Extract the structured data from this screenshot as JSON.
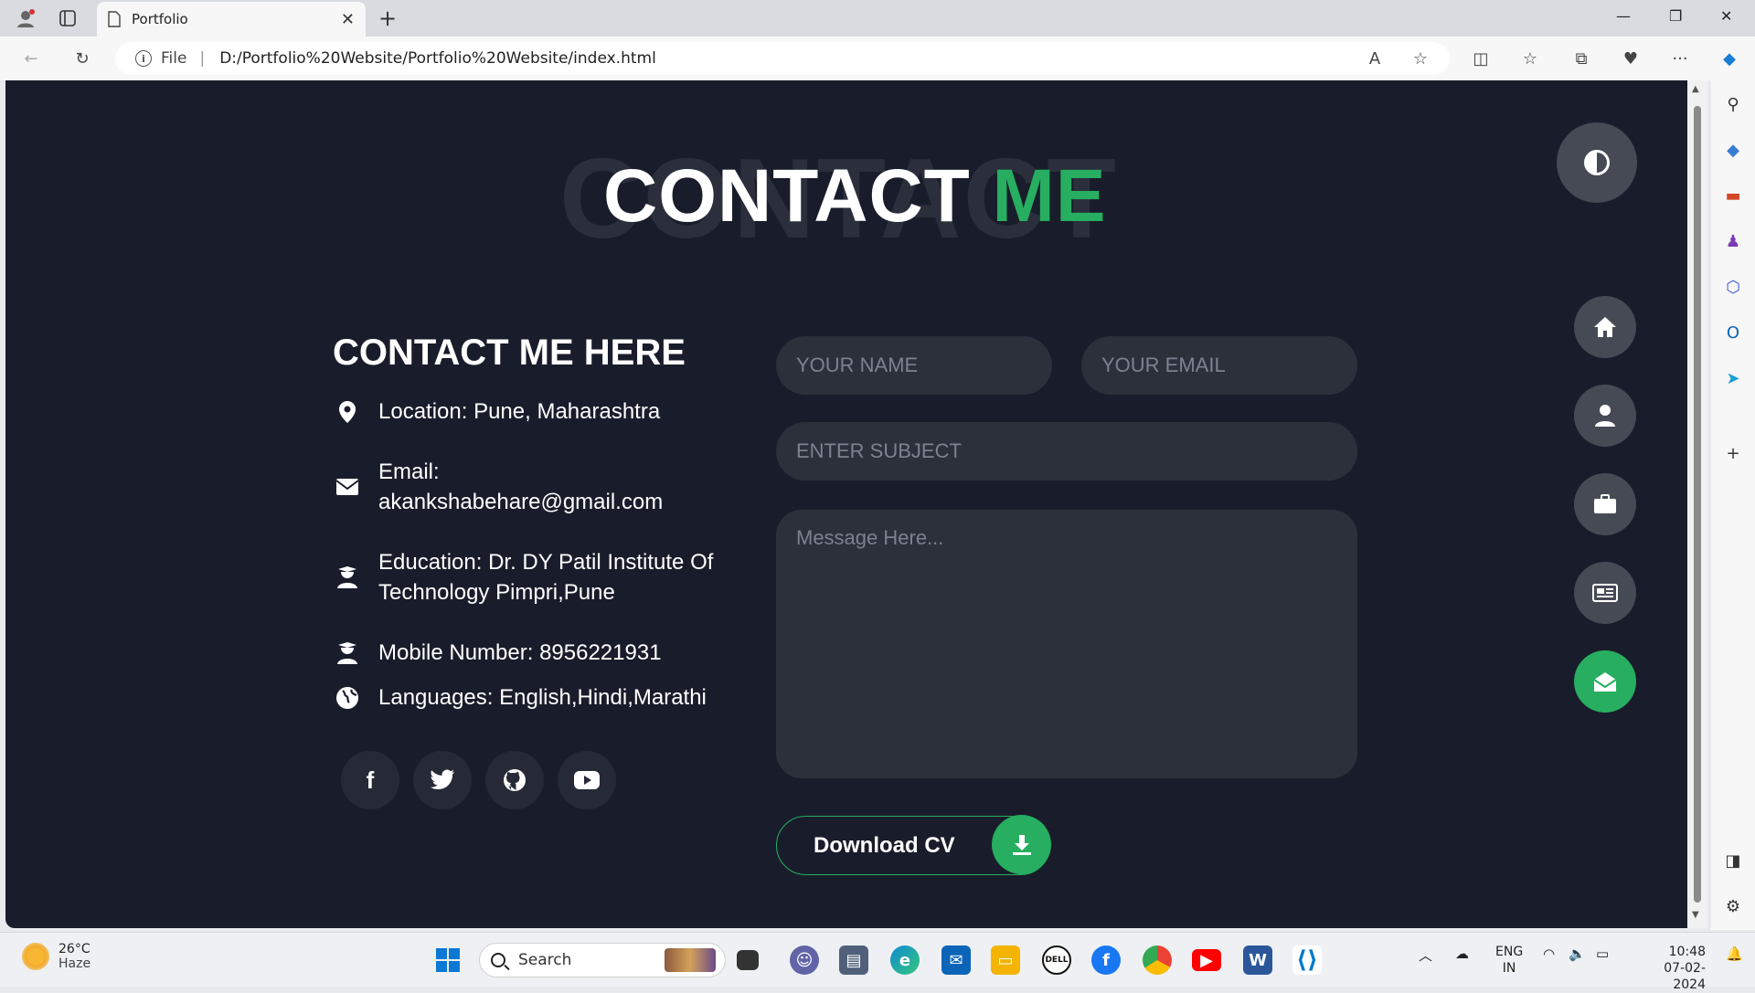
{
  "browser": {
    "tab_title": "Portfolio",
    "address_prefix": "File",
    "url": "D:/Portfolio%20Website/Portfolio%20Website/index.html"
  },
  "page": {
    "background_title": "CONTACT",
    "title_main": "CONTACT",
    "title_accent": "ME",
    "accent_color": "#27ae60",
    "subheading": "CONTACT ME HERE",
    "info": [
      {
        "icon": "location-pin-icon",
        "text": "Location: Pune, Maharashtra"
      },
      {
        "icon": "envelope-icon",
        "text": "Email: akankshabehare@gmail.com"
      },
      {
        "icon": "graduate-icon",
        "text": "Education: Dr. DY Patil Institute Of Technology Pimpri,Pune"
      },
      {
        "icon": "graduate-icon",
        "text": "Mobile Number: 8956221931"
      },
      {
        "icon": "globe-icon",
        "text": "Languages: English,Hindi,Marathi"
      }
    ],
    "social": [
      "facebook-icon",
      "twitter-icon",
      "github-icon",
      "youtube-icon"
    ],
    "form": {
      "name_placeholder": "YOUR NAME",
      "email_placeholder": "YOUR EMAIL",
      "subject_placeholder": "ENTER SUBJECT",
      "message_placeholder": "Message Here..."
    },
    "download_label": "Download CV",
    "nav": [
      "home-icon",
      "user-icon",
      "briefcase-icon",
      "newspaper-icon",
      "envelope-open-icon"
    ],
    "nav_active": 4
  },
  "taskbar": {
    "temperature": "26°C",
    "weather": "Haze",
    "search_label": "Search",
    "lang_1": "ENG",
    "lang_2": "IN",
    "time": "10:48",
    "date": "07-02-2024"
  }
}
